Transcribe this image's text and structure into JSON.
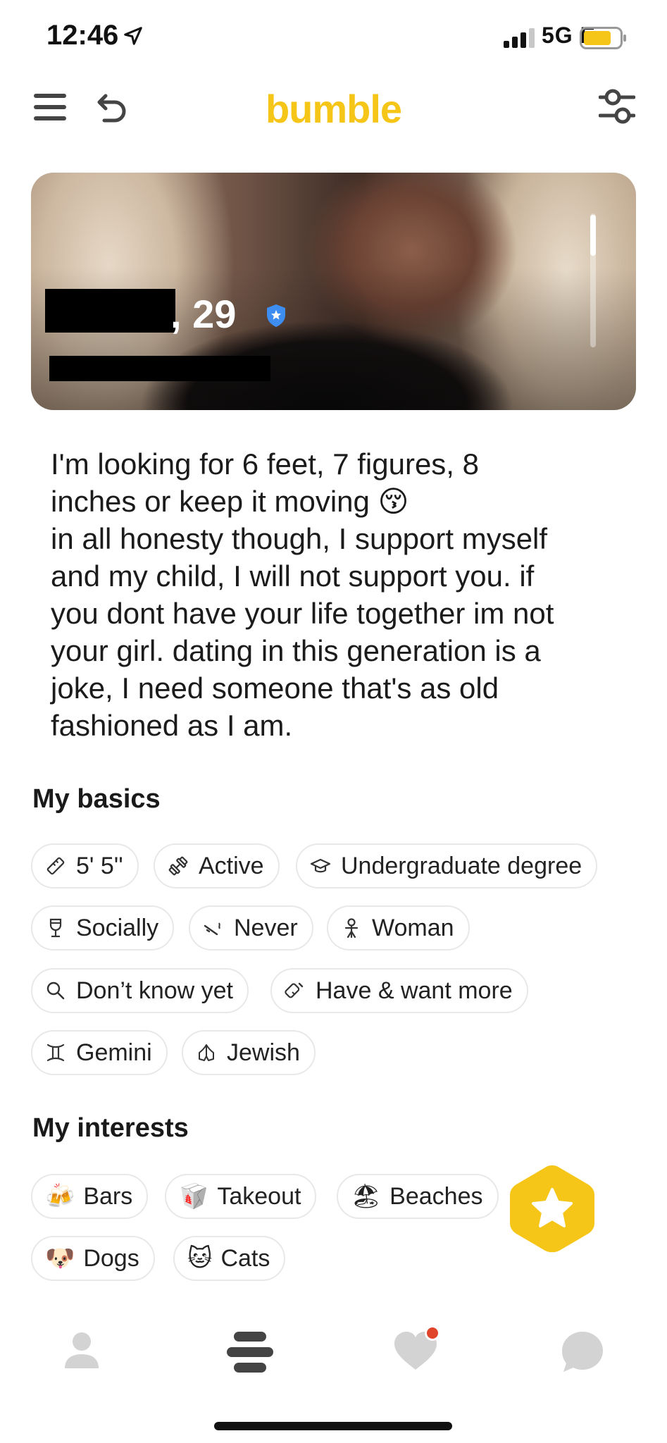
{
  "status_bar": {
    "time": "12:46",
    "network": "5G E"
  },
  "header": {
    "logo": "bumble"
  },
  "profile": {
    "age": ", 29"
  },
  "bio": "I'm looking for 6 feet, 7 figures, 8\ninches or keep it moving 😚\nin all honesty though, I support myself\nand my child, I will not support you. if\nyou dont have your life together im not\nyour girl. dating in this generation is a\njoke, I need someone that's as old\nfashioned as I am.",
  "basics": {
    "title": "My basics",
    "items": [
      {
        "icon": "ruler-icon",
        "label": "5' 5''"
      },
      {
        "icon": "dumbbell-icon",
        "label": "Active"
      },
      {
        "icon": "graduation-cap-icon",
        "label": "Undergraduate degree"
      },
      {
        "icon": "wine-glass-icon",
        "label": "Socially"
      },
      {
        "icon": "no-smoking-icon",
        "label": "Never"
      },
      {
        "icon": "person-icon",
        "label": "Woman"
      },
      {
        "icon": "search-icon",
        "label": "Don’t know yet"
      },
      {
        "icon": "baby-bottle-icon",
        "label": "Have & want more"
      },
      {
        "icon": "zodiac-icon",
        "label": "Gemini"
      },
      {
        "icon": "praying-hands-icon",
        "label": "Jewish"
      }
    ]
  },
  "interests": {
    "title": "My interests",
    "items": [
      {
        "emoji": "🍻",
        "label": "Bars"
      },
      {
        "emoji": "🥡",
        "label": "Takeout"
      },
      {
        "emoji": "🏖",
        "label": "Beaches"
      },
      {
        "emoji": "🐶",
        "label": "Dogs"
      },
      {
        "emoji": "🐱",
        "label": "Cats"
      }
    ]
  },
  "colors": {
    "brand": "#f5c518",
    "chip_border": "#e8e8e8",
    "nav_icon": "#d3d3d3",
    "notification": "#e0452b"
  }
}
